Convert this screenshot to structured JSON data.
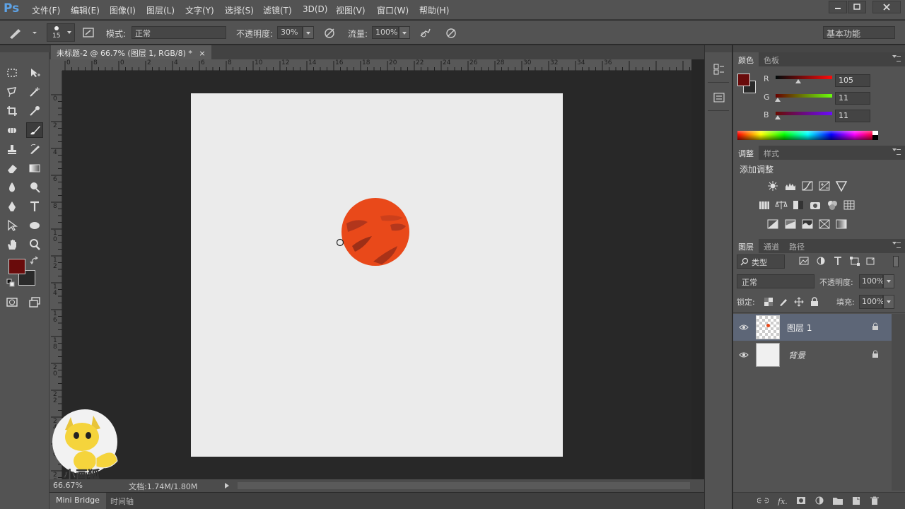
{
  "app": {
    "logo": "Ps",
    "menu": [
      "文件(F)",
      "编辑(E)",
      "图像(I)",
      "图层(L)",
      "文字(Y)",
      "选择(S)",
      "滤镜(T)",
      "3D(D)",
      "视图(V)",
      "窗口(W)",
      "帮助(H)"
    ]
  },
  "options": {
    "brush_size": "15",
    "mode_label": "模式:",
    "mode_value": "正常",
    "opacity_label": "不透明度:",
    "opacity_value": "30%",
    "flow_label": "流量:",
    "flow_value": "100%",
    "workspace": "基本功能"
  },
  "document": {
    "tab_title": "未标题-2 @ 66.7% (图层 1, RGB/8) *",
    "close": "×",
    "ruler_h_labels": [
      "0",
      "8",
      "0",
      "2",
      "4",
      "6",
      "8",
      "10",
      "12",
      "14",
      "16",
      "18",
      "20",
      "22",
      "24",
      "26",
      "28",
      "30",
      "32",
      "34",
      "36"
    ],
    "ruler_v_labels": [
      "0",
      "2",
      "4",
      "6",
      "8",
      "1 0",
      "1 2",
      "1 4",
      "1 6",
      "1 8",
      "2 0",
      "2 2",
      "2 4",
      "2 6",
      "2 8"
    ],
    "planet_color": "#e9491a"
  },
  "status": {
    "zoom": "66.67%",
    "doc_size": "文档:1.74M/1.80M"
  },
  "bottom_tabs": [
    "Mini Bridge",
    "时间轴"
  ],
  "watermark": "小画狐",
  "color_panel": {
    "tabs": [
      "颜色",
      "色板"
    ],
    "foreground": "#690b0b",
    "channels": [
      {
        "name": "R",
        "value": "105"
      },
      {
        "name": "G",
        "value": "11"
      },
      {
        "name": "B",
        "value": "11"
      }
    ]
  },
  "adjust_panel": {
    "tabs": [
      "调整",
      "样式"
    ],
    "heading": "添加调整"
  },
  "layers_panel": {
    "tabs": [
      "图层",
      "通道",
      "路径"
    ],
    "filter_kind": "类型",
    "blend_mode": "正常",
    "opacity_label": "不透明度:",
    "opacity_value": "100%",
    "lock_label": "锁定:",
    "fill_label": "填充:",
    "fill_value": "100%",
    "layers": [
      {
        "name": "图层 1",
        "selected": true
      },
      {
        "name": "背景",
        "selected": false
      }
    ]
  }
}
